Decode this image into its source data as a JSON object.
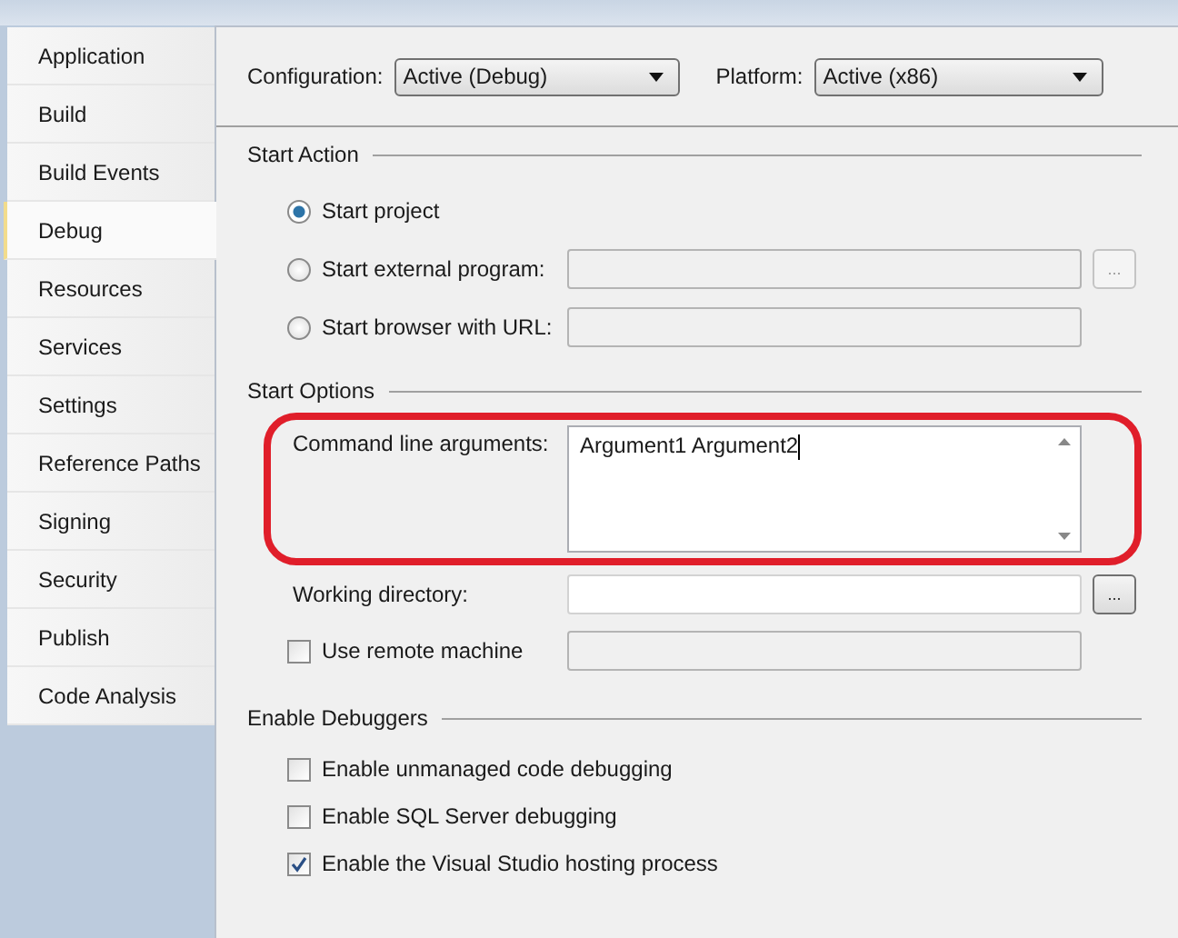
{
  "sidebar": {
    "tabs": [
      {
        "label": "Application",
        "selected": false
      },
      {
        "label": "Build",
        "selected": false
      },
      {
        "label": "Build Events",
        "selected": false
      },
      {
        "label": "Debug",
        "selected": true
      },
      {
        "label": "Resources",
        "selected": false
      },
      {
        "label": "Services",
        "selected": false
      },
      {
        "label": "Settings",
        "selected": false
      },
      {
        "label": "Reference Paths",
        "selected": false
      },
      {
        "label": "Signing",
        "selected": false
      },
      {
        "label": "Security",
        "selected": false
      },
      {
        "label": "Publish",
        "selected": false
      },
      {
        "label": "Code Analysis",
        "selected": false
      }
    ]
  },
  "configuration": {
    "label": "Configuration:",
    "value": "Active (Debug)"
  },
  "platform": {
    "label": "Platform:",
    "value": "Active (x86)"
  },
  "start_action": {
    "heading": "Start Action",
    "options": [
      {
        "label": "Start project",
        "selected": true,
        "has_field": false
      },
      {
        "label": "Start external program:",
        "selected": false,
        "has_field": true,
        "browse": "..."
      },
      {
        "label": "Start browser with URL:",
        "selected": false,
        "has_field": true
      }
    ]
  },
  "start_options": {
    "heading": "Start Options",
    "command_line": {
      "label": "Command line arguments:",
      "value": "Argument1 Argument2",
      "highlighted": true
    },
    "working_directory": {
      "label": "Working directory:",
      "browse": "..."
    },
    "remote": {
      "label": "Use remote machine",
      "checked": false
    }
  },
  "debuggers": {
    "heading": "Enable Debuggers",
    "options": [
      {
        "label": "Enable unmanaged code debugging",
        "checked": false
      },
      {
        "label": "Enable SQL Server debugging",
        "checked": false
      },
      {
        "label": "Enable the Visual Studio hosting process",
        "checked": true
      }
    ]
  }
}
